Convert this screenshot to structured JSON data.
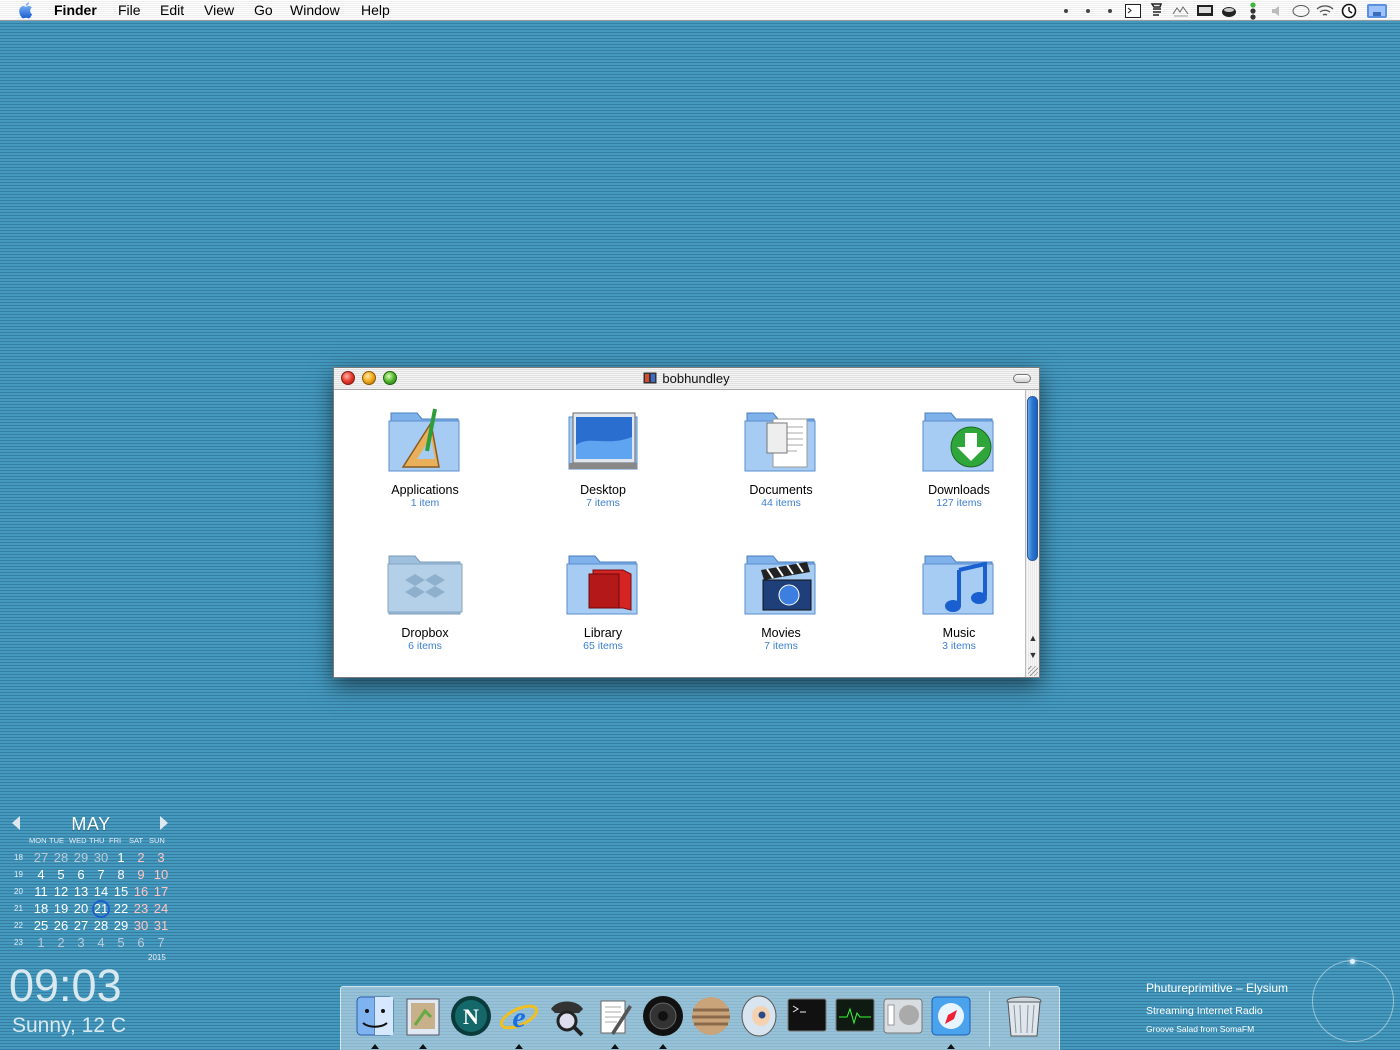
{
  "menubar": {
    "app": "Finder",
    "menus": [
      "File",
      "Edit",
      "View",
      "Go",
      "Window",
      "Help"
    ],
    "extras": [
      "menu-dot-icon",
      "menu-dot-icon",
      "menu-dot-icon",
      "terminal-icon",
      "script-icon",
      "displays-icon",
      "screen-icon",
      "coffee-icon",
      "traffic-icon",
      "volume-icon",
      "chat-icon",
      "wifi-icon",
      "clock-icon",
      "user-icon"
    ]
  },
  "window": {
    "title": "bobhundley",
    "items": [
      {
        "name": "Applications",
        "count": "1 item"
      },
      {
        "name": "Desktop",
        "count": "7 items"
      },
      {
        "name": "Documents",
        "count": "44 items"
      },
      {
        "name": "Downloads",
        "count": "127 items"
      },
      {
        "name": "Dropbox",
        "count": "6 items"
      },
      {
        "name": "Library",
        "count": "65 items"
      },
      {
        "name": "Movies",
        "count": "7 items"
      },
      {
        "name": "Music",
        "count": "3 items"
      }
    ]
  },
  "calendar": {
    "month": "MAY",
    "year": "2015",
    "dow": [
      "MON",
      "TUE",
      "WED",
      "THU",
      "FRI",
      "SAT",
      "SUN"
    ],
    "weeks": [
      {
        "wk": "18",
        "days": [
          "27",
          "28",
          "29",
          "30",
          "1",
          "2",
          "3"
        ]
      },
      {
        "wk": "19",
        "days": [
          "4",
          "5",
          "6",
          "7",
          "8",
          "9",
          "10"
        ]
      },
      {
        "wk": "20",
        "days": [
          "11",
          "12",
          "13",
          "14",
          "15",
          "16",
          "17"
        ]
      },
      {
        "wk": "21",
        "days": [
          "18",
          "19",
          "20",
          "21",
          "22",
          "23",
          "24"
        ]
      },
      {
        "wk": "22",
        "days": [
          "25",
          "26",
          "27",
          "28",
          "29",
          "30",
          "31"
        ]
      },
      {
        "wk": "23",
        "days": [
          "1",
          "2",
          "3",
          "4",
          "5",
          "6",
          "7"
        ]
      }
    ],
    "today": "21"
  },
  "clock": {
    "time": "09:03",
    "weather": "Sunny, 12 C"
  },
  "radio": {
    "track": "Phutureprimitive – Elysium",
    "line2": "Streaming Internet Radio",
    "line3": "Groove Salad from SomaFM"
  },
  "dock": {
    "apps": [
      "finder-icon",
      "mail-icon",
      "netscape-icon",
      "internet-explorer-icon",
      "sherlock-icon",
      "textedit-icon",
      "speaker-icon",
      "jupiter-icon",
      "preview-icon",
      "terminal-icon",
      "activity-monitor-icon",
      "system-preferences-icon",
      "safari-icon"
    ],
    "running": [
      "finder-icon",
      "mail-icon",
      "internet-explorer-icon",
      "textedit-icon",
      "speaker-icon",
      "safari-icon"
    ],
    "trash": "trash-icon"
  }
}
